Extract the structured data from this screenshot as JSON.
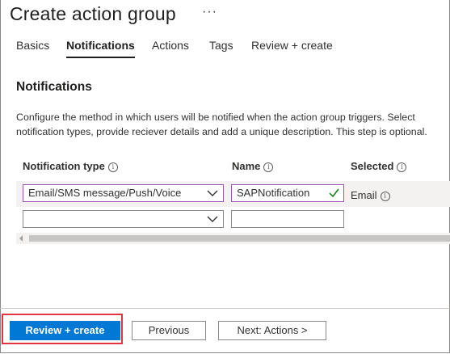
{
  "header": {
    "title": "Create action group",
    "more": "···"
  },
  "tabs": [
    {
      "label": "Basics"
    },
    {
      "label": "Notifications"
    },
    {
      "label": "Actions"
    },
    {
      "label": "Tags"
    },
    {
      "label": "Review + create"
    }
  ],
  "active_tab": "Notifications",
  "section": {
    "title": "Notifications",
    "description": "Configure the method in which users will be notified when the action group triggers. Select notification types, provide reciever details and add a unique description. This step is optional."
  },
  "table": {
    "columns": [
      {
        "label": "Notification type"
      },
      {
        "label": "Name"
      },
      {
        "label": "Selected"
      }
    ],
    "rows": [
      {
        "type": "Email/SMS message/Push/Voice",
        "name": "SAPNotification",
        "selected": "Email"
      },
      {
        "type": "",
        "name": "",
        "selected": ""
      }
    ]
  },
  "footer": {
    "review_create": "Review + create",
    "previous": "Previous",
    "next": "Next: Actions >"
  },
  "colors": {
    "accent": "#0078d4",
    "highlight_border": "#9a55b0",
    "callout": "#e3343f",
    "check": "#107c10"
  },
  "icons": [
    "info-icon",
    "chevron-down-icon",
    "checkmark-icon",
    "scroll-left-icon"
  ]
}
